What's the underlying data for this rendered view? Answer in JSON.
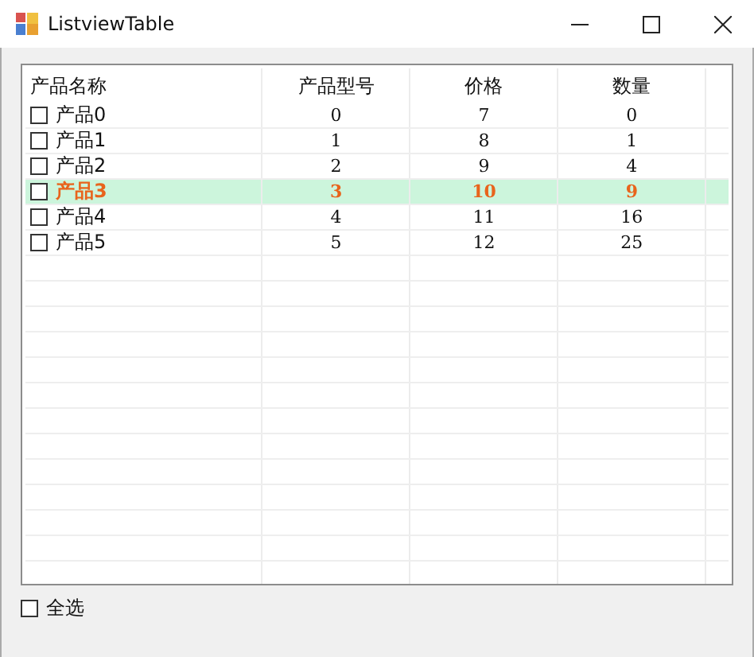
{
  "window": {
    "title": "ListviewTable"
  },
  "table": {
    "columns": [
      "产品名称",
      "产品型号",
      "价格",
      "数量"
    ],
    "rows": [
      {
        "checked": false,
        "highlighted": false,
        "cells": [
          "产品0",
          "0",
          "7",
          "0"
        ]
      },
      {
        "checked": false,
        "highlighted": false,
        "cells": [
          "产品1",
          "1",
          "8",
          "1"
        ]
      },
      {
        "checked": false,
        "highlighted": false,
        "cells": [
          "产品2",
          "2",
          "9",
          "4"
        ]
      },
      {
        "checked": false,
        "highlighted": true,
        "cells": [
          "产品3",
          "3",
          "10",
          "9"
        ]
      },
      {
        "checked": false,
        "highlighted": false,
        "cells": [
          "产品4",
          "4",
          "11",
          "16"
        ]
      },
      {
        "checked": false,
        "highlighted": false,
        "cells": [
          "产品5",
          "5",
          "12",
          "25"
        ]
      }
    ]
  },
  "select_all": {
    "label": "全选",
    "checked": false
  }
}
